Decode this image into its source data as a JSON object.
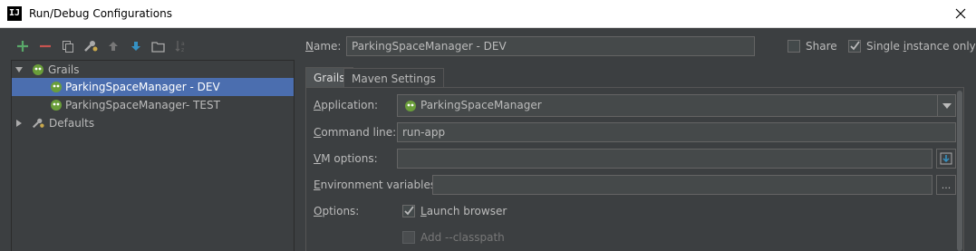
{
  "window": {
    "title": "Run/Debug Configurations",
    "app_icon_text": "IJ"
  },
  "toolbar": {
    "icons": [
      "add-icon",
      "remove-icon",
      "copy-icon",
      "edit-defaults-icon",
      "move-up-icon",
      "move-down-icon",
      "folder-icon",
      "sort-icon"
    ]
  },
  "tree": {
    "grails_group": "Grails",
    "items": [
      {
        "label": "ParkingSpaceManager - DEV",
        "selected": true
      },
      {
        "label": "ParkingSpaceManager- TEST",
        "selected": false
      }
    ],
    "defaults_group": "Defaults"
  },
  "form": {
    "name_label_u": "N",
    "name_label_rest": "ame:",
    "name_value": "ParkingSpaceManager - DEV",
    "share_label": "Share",
    "share_checked": false,
    "single_instance_pre": "Single ",
    "single_instance_u": "i",
    "single_instance_post": "nstance only",
    "single_instance_checked": true
  },
  "tabs": [
    {
      "label": "Grails",
      "active": true
    },
    {
      "label": "Maven Settings",
      "active": false
    }
  ],
  "grails_tab": {
    "application_label_u": "A",
    "application_label_rest": "pplication:",
    "application_value": "ParkingSpaceManager",
    "command_line_label_u": "C",
    "command_line_label_rest": "ommand line:",
    "command_line_value": "run-app",
    "vm_options_label_u": "V",
    "vm_options_label_rest": "M options:",
    "vm_options_value": "",
    "env_vars_label_u": "E",
    "env_vars_label_rest": "nvironment variables:",
    "env_vars_value": "",
    "env_vars_button": "...",
    "options_label_u": "O",
    "options_label_rest": "ptions:",
    "launch_browser_u": "L",
    "launch_browser_rest": "aunch browser",
    "launch_browser_checked": true,
    "add_classpath_label": "Add --classpath",
    "add_classpath_checked": false
  },
  "colors": {
    "background": "#3c3f41",
    "selection": "#4b6eaf",
    "add_icon": "#59a869",
    "remove_icon": "#c75450",
    "grails_icon": "#6a9e3a"
  }
}
